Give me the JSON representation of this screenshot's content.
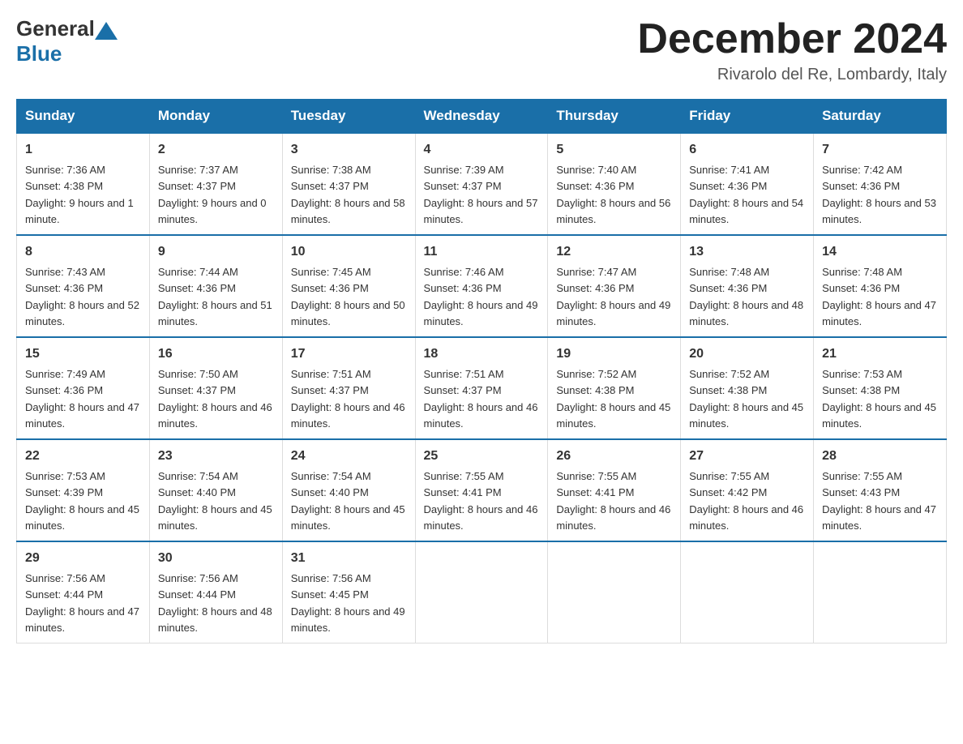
{
  "header": {
    "logo": {
      "general": "General",
      "blue": "Blue"
    },
    "title": "December 2024",
    "location": "Rivarolo del Re, Lombardy, Italy"
  },
  "days_of_week": [
    "Sunday",
    "Monday",
    "Tuesday",
    "Wednesday",
    "Thursday",
    "Friday",
    "Saturday"
  ],
  "weeks": [
    [
      {
        "day": "1",
        "sunrise": "7:36 AM",
        "sunset": "4:38 PM",
        "daylight": "9 hours and 1 minute."
      },
      {
        "day": "2",
        "sunrise": "7:37 AM",
        "sunset": "4:37 PM",
        "daylight": "9 hours and 0 minutes."
      },
      {
        "day": "3",
        "sunrise": "7:38 AM",
        "sunset": "4:37 PM",
        "daylight": "8 hours and 58 minutes."
      },
      {
        "day": "4",
        "sunrise": "7:39 AM",
        "sunset": "4:37 PM",
        "daylight": "8 hours and 57 minutes."
      },
      {
        "day": "5",
        "sunrise": "7:40 AM",
        "sunset": "4:36 PM",
        "daylight": "8 hours and 56 minutes."
      },
      {
        "day": "6",
        "sunrise": "7:41 AM",
        "sunset": "4:36 PM",
        "daylight": "8 hours and 54 minutes."
      },
      {
        "day": "7",
        "sunrise": "7:42 AM",
        "sunset": "4:36 PM",
        "daylight": "8 hours and 53 minutes."
      }
    ],
    [
      {
        "day": "8",
        "sunrise": "7:43 AM",
        "sunset": "4:36 PM",
        "daylight": "8 hours and 52 minutes."
      },
      {
        "day": "9",
        "sunrise": "7:44 AM",
        "sunset": "4:36 PM",
        "daylight": "8 hours and 51 minutes."
      },
      {
        "day": "10",
        "sunrise": "7:45 AM",
        "sunset": "4:36 PM",
        "daylight": "8 hours and 50 minutes."
      },
      {
        "day": "11",
        "sunrise": "7:46 AM",
        "sunset": "4:36 PM",
        "daylight": "8 hours and 49 minutes."
      },
      {
        "day": "12",
        "sunrise": "7:47 AM",
        "sunset": "4:36 PM",
        "daylight": "8 hours and 49 minutes."
      },
      {
        "day": "13",
        "sunrise": "7:48 AM",
        "sunset": "4:36 PM",
        "daylight": "8 hours and 48 minutes."
      },
      {
        "day": "14",
        "sunrise": "7:48 AM",
        "sunset": "4:36 PM",
        "daylight": "8 hours and 47 minutes."
      }
    ],
    [
      {
        "day": "15",
        "sunrise": "7:49 AM",
        "sunset": "4:36 PM",
        "daylight": "8 hours and 47 minutes."
      },
      {
        "day": "16",
        "sunrise": "7:50 AM",
        "sunset": "4:37 PM",
        "daylight": "8 hours and 46 minutes."
      },
      {
        "day": "17",
        "sunrise": "7:51 AM",
        "sunset": "4:37 PM",
        "daylight": "8 hours and 46 minutes."
      },
      {
        "day": "18",
        "sunrise": "7:51 AM",
        "sunset": "4:37 PM",
        "daylight": "8 hours and 46 minutes."
      },
      {
        "day": "19",
        "sunrise": "7:52 AM",
        "sunset": "4:38 PM",
        "daylight": "8 hours and 45 minutes."
      },
      {
        "day": "20",
        "sunrise": "7:52 AM",
        "sunset": "4:38 PM",
        "daylight": "8 hours and 45 minutes."
      },
      {
        "day": "21",
        "sunrise": "7:53 AM",
        "sunset": "4:38 PM",
        "daylight": "8 hours and 45 minutes."
      }
    ],
    [
      {
        "day": "22",
        "sunrise": "7:53 AM",
        "sunset": "4:39 PM",
        "daylight": "8 hours and 45 minutes."
      },
      {
        "day": "23",
        "sunrise": "7:54 AM",
        "sunset": "4:40 PM",
        "daylight": "8 hours and 45 minutes."
      },
      {
        "day": "24",
        "sunrise": "7:54 AM",
        "sunset": "4:40 PM",
        "daylight": "8 hours and 45 minutes."
      },
      {
        "day": "25",
        "sunrise": "7:55 AM",
        "sunset": "4:41 PM",
        "daylight": "8 hours and 46 minutes."
      },
      {
        "day": "26",
        "sunrise": "7:55 AM",
        "sunset": "4:41 PM",
        "daylight": "8 hours and 46 minutes."
      },
      {
        "day": "27",
        "sunrise": "7:55 AM",
        "sunset": "4:42 PM",
        "daylight": "8 hours and 46 minutes."
      },
      {
        "day": "28",
        "sunrise": "7:55 AM",
        "sunset": "4:43 PM",
        "daylight": "8 hours and 47 minutes."
      }
    ],
    [
      {
        "day": "29",
        "sunrise": "7:56 AM",
        "sunset": "4:44 PM",
        "daylight": "8 hours and 47 minutes."
      },
      {
        "day": "30",
        "sunrise": "7:56 AM",
        "sunset": "4:44 PM",
        "daylight": "8 hours and 48 minutes."
      },
      {
        "day": "31",
        "sunrise": "7:56 AM",
        "sunset": "4:45 PM",
        "daylight": "8 hours and 49 minutes."
      },
      null,
      null,
      null,
      null
    ]
  ],
  "labels": {
    "sunrise": "Sunrise:",
    "sunset": "Sunset:",
    "daylight": "Daylight:"
  }
}
